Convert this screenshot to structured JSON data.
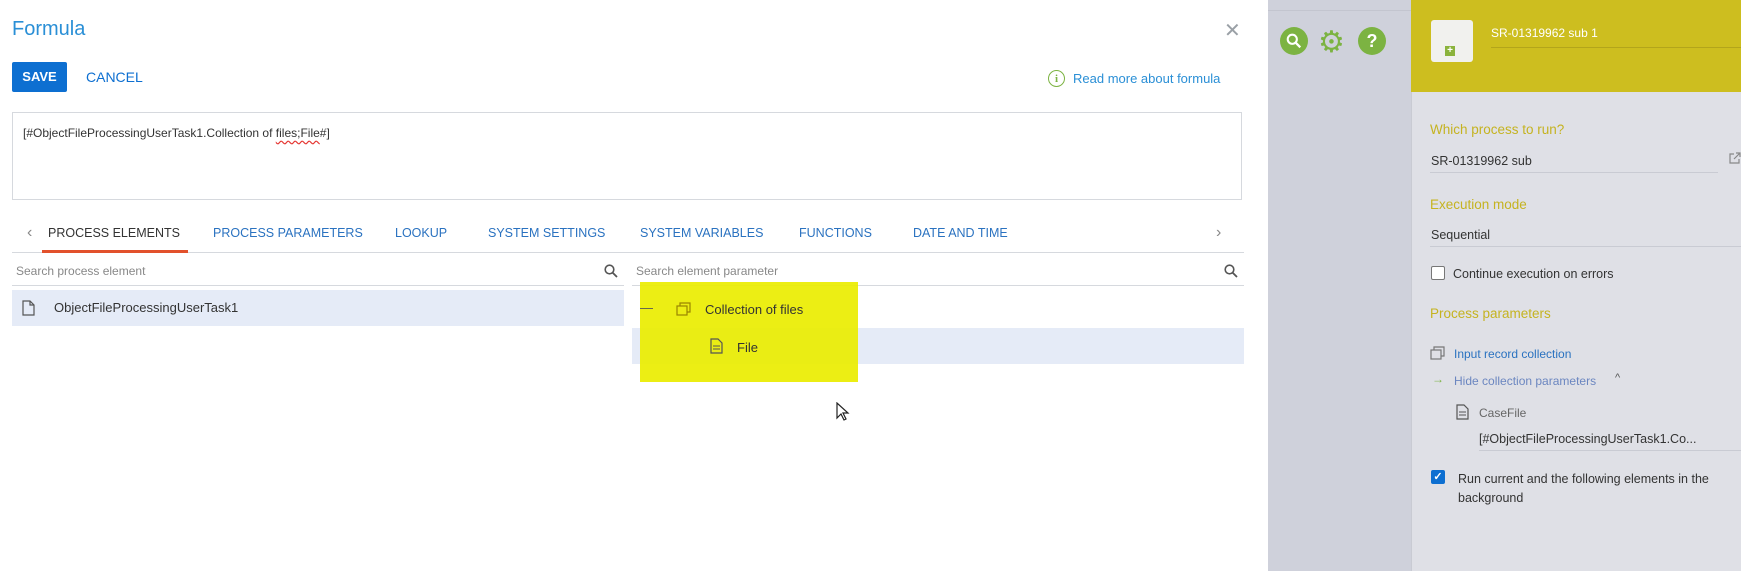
{
  "dialog": {
    "title": "Formula",
    "save_label": "SAVE",
    "cancel_label": "CANCEL",
    "read_more_label": "Read more about formula",
    "formula_prefix": "[#ObjectFileProcessingUserTask1.Collection of ",
    "formula_squiggle": "files;File",
    "formula_suffix": "#]"
  },
  "tabs": [
    {
      "label": "PROCESS ELEMENTS"
    },
    {
      "label": "PROCESS PARAMETERS"
    },
    {
      "label": "LOOKUP"
    },
    {
      "label": "SYSTEM SETTINGS"
    },
    {
      "label": "SYSTEM VARIABLES"
    },
    {
      "label": "FUNCTIONS"
    },
    {
      "label": "DATE AND TIME"
    }
  ],
  "left_list": {
    "search_placeholder": "Search process element",
    "items": [
      {
        "label": "ObjectFileProcessingUserTask1"
      }
    ]
  },
  "right_list": {
    "search_placeholder": "Search element parameter",
    "collapse_glyph": "—",
    "items": [
      {
        "label": "Collection of files"
      },
      {
        "label": "File"
      }
    ]
  },
  "toolbar": {
    "search_icon": "magnifier-icon",
    "settings_icon": "gear-icon",
    "help_icon": "question-icon"
  },
  "properties": {
    "element_name": "SR-01319962 sub 1",
    "which_process_label": "Which process to run?",
    "which_process_value": "SR-01319962 sub",
    "execution_mode_label": "Execution mode",
    "execution_mode_value": "Sequential",
    "continue_on_errors_label": "Continue execution on errors",
    "continue_on_errors_checked": false,
    "process_parameters_label": "Process parameters",
    "input_collection_label": "Input record collection",
    "hide_collection_label": "Hide collection parameters",
    "case_file_label": "CaseFile",
    "case_file_value": "[#ObjectFileProcessingUserTask1.Co...",
    "run_background_label": "Run current and the following elements in the background",
    "run_background_checked": true
  },
  "colors": {
    "accent": "#0d6fd1",
    "highlight": "#eaed00",
    "header_yellow": "#cdbe1f",
    "label_gold": "#c5b320",
    "tab_underline": "#e2512c"
  }
}
